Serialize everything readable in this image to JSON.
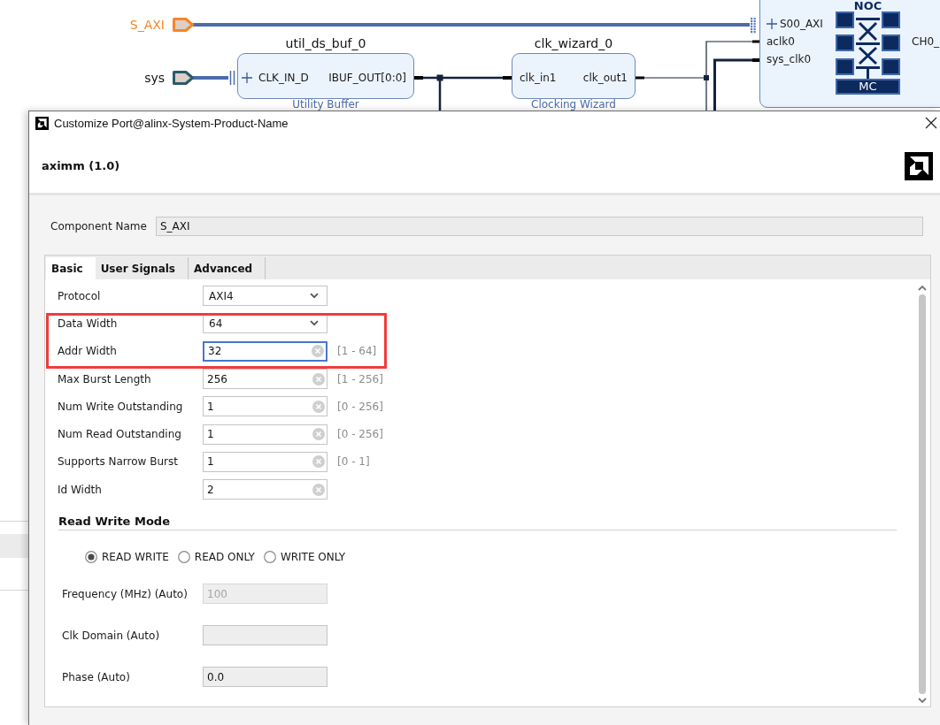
{
  "diagram": {
    "ports": [
      {
        "label": "S_AXI",
        "selected": true
      },
      {
        "label": "sys",
        "selected": false
      }
    ],
    "blocks": [
      {
        "title": "util_ds_buf_0",
        "subtitle": "Utility Buffer",
        "inputs": [
          {
            "label": "CLK_IN_D",
            "kind": "interface"
          }
        ],
        "outputs": [
          {
            "label": "IBUF_OUT[0:0]"
          }
        ]
      },
      {
        "title": "clk_wizard_0",
        "subtitle": "Clocking Wizard",
        "inputs": [
          {
            "label": "clk_in1",
            "kind": "clock"
          }
        ],
        "outputs": [
          {
            "label": "clk_out1"
          }
        ]
      }
    ],
    "noc": {
      "title": "NOC",
      "inputs": [
        {
          "label": "S00_AXI",
          "kind": "interface"
        },
        {
          "label": "aclk0",
          "kind": "clock"
        },
        {
          "label": "sys_clk0",
          "kind": "clock"
        }
      ],
      "core_label": "MC",
      "outputs": [
        {
          "label": "CH0_"
        }
      ]
    }
  },
  "dialog": {
    "title": "Customize Port@alinx-System-Product-Name",
    "heading": "aximm (1.0)",
    "component_name": {
      "label": "Component Name",
      "value": "S_AXI"
    },
    "tabs": [
      {
        "label": "Basic",
        "selected": true
      },
      {
        "label": "User Signals",
        "selected": false
      },
      {
        "label": "Advanced",
        "selected": false
      }
    ],
    "parameters": [
      {
        "kind": "dropdown",
        "label": "Protocol",
        "value": "AXI4",
        "focused": false,
        "highlighted": false
      },
      {
        "kind": "dropdown",
        "label": "Data Width",
        "value": "64",
        "focused": false,
        "highlighted": true
      },
      {
        "kind": "text",
        "label": "Addr Width",
        "value": "32",
        "range": "[1 - 64]",
        "focused": true,
        "highlighted": true
      },
      {
        "kind": "text",
        "label": "Max Burst Length",
        "value": "256",
        "range": "[1 - 256]",
        "focused": false,
        "highlighted": false
      },
      {
        "kind": "text",
        "label": "Num Write Outstanding",
        "value": "1",
        "range": "[0 - 256]",
        "focused": false,
        "highlighted": false
      },
      {
        "kind": "text",
        "label": "Num Read Outstanding",
        "value": "1",
        "range": "[0 - 256]",
        "focused": false,
        "highlighted": false
      },
      {
        "kind": "text",
        "label": "Supports Narrow Burst",
        "value": "1",
        "range": "[0 - 1]",
        "focused": false,
        "highlighted": false
      },
      {
        "kind": "text",
        "label": "Id Width",
        "value": "2",
        "focused": false,
        "highlighted": false
      }
    ],
    "read_write_mode": {
      "title": "Read Write Mode",
      "options": [
        {
          "label": "READ WRITE",
          "selected": true
        },
        {
          "label": "READ ONLY",
          "selected": false
        },
        {
          "label": "WRITE ONLY",
          "selected": false
        }
      ]
    },
    "auto_fields": [
      {
        "label": "Frequency (MHz) (Auto)",
        "value": "100",
        "disabled": true
      },
      {
        "label": "Clk Domain (Auto)",
        "disabled": false
      },
      {
        "label": "Phase (Auto)",
        "value": "0.0",
        "disabled": false
      }
    ]
  }
}
